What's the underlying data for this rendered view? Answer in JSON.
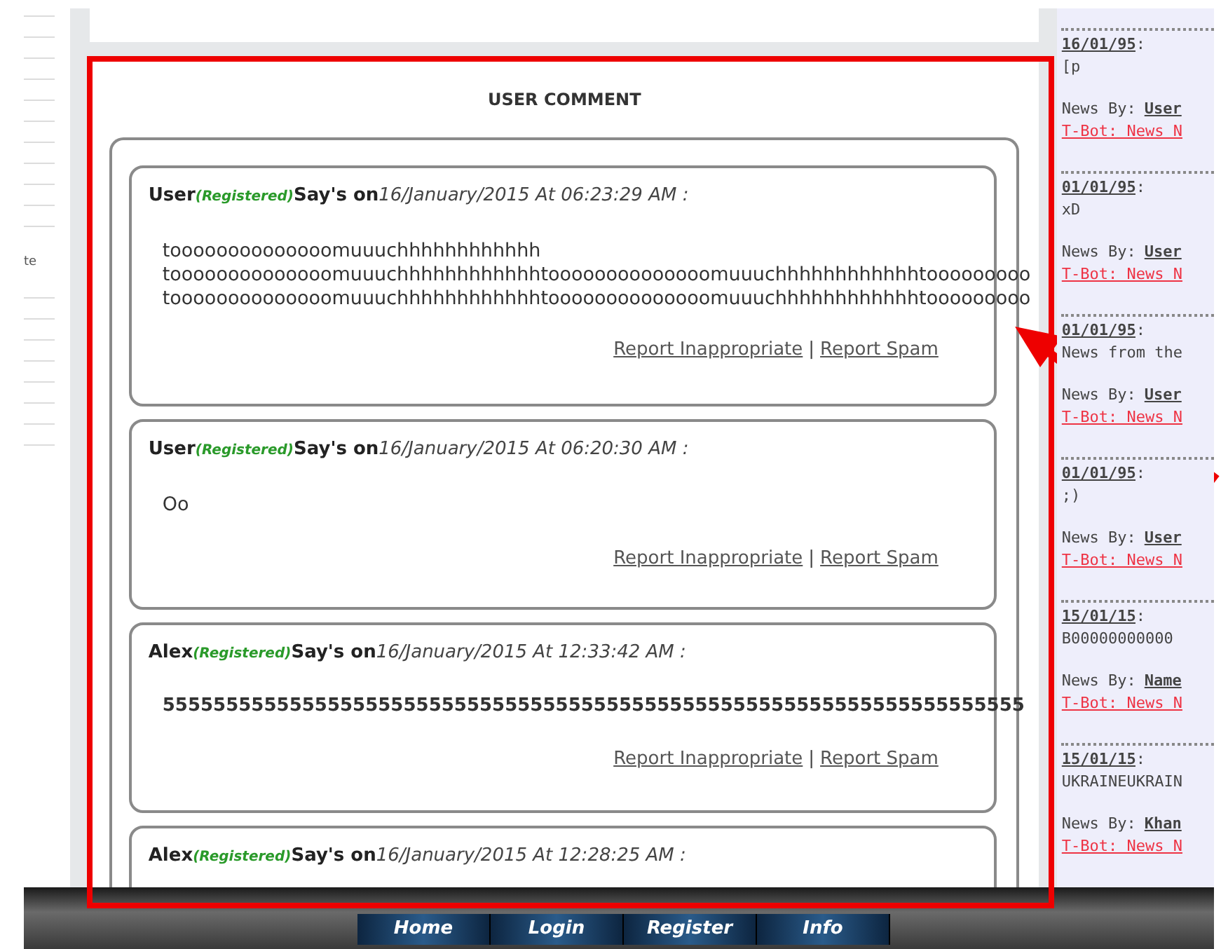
{
  "left_strip": {
    "text": "te"
  },
  "title": "USER COMMENT",
  "comments": [
    {
      "author": "User",
      "status": "(Registered)",
      "says": "Say's on",
      "date": "16/January/2015 At 06:23:29 AM :",
      "bold_body": false,
      "body": [
        "toooooooooooooomuuuchhhhhhhhhhhh",
        "toooooooooooooomuuuchhhhhhhhhhhhtoooooooooooooomuuuchhhhhhhhhhhhtooooooooo",
        "toooooooooooooomuuuchhhhhhhhhhhhtoooooooooooooomuuuchhhhhhhhhhhhtooooooooo"
      ],
      "links": [
        "Report Inappropriate",
        "Report Spam"
      ],
      "separator": "|"
    },
    {
      "author": "User",
      "status": "(Registered)",
      "says": "Say's on",
      "date": "16/January/2015 At 06:20:30 AM :",
      "bold_body": false,
      "body": [
        "Oo"
      ],
      "links": [
        "Report Inappropriate",
        "Report Spam"
      ],
      "separator": "|"
    },
    {
      "author": "Alex",
      "status": "(Registered)",
      "says": "Say's on",
      "date": "16/January/2015 At 12:33:42 AM :",
      "body": [
        "55555555555555555555555555555555555555555555555555555555555555555555"
      ],
      "bold_body": true,
      "links": [
        "Report Inappropriate",
        "Report Spam"
      ],
      "separator": "|"
    },
    {
      "author": "Alex",
      "status": "(Registered)",
      "says": "Say's on",
      "date": "16/January/2015 At 12:28:25 AM :"
    }
  ],
  "news": [
    {
      "date": "16/01/95",
      "colon": ":",
      "text": "[p",
      "by_label": "News By:",
      "author": "User",
      "tag": "T-Bot: News N"
    },
    {
      "date": "01/01/95",
      "colon": ":",
      "text": "xD",
      "by_label": "News By:",
      "author": "User",
      "tag": "T-Bot: News N"
    },
    {
      "date": "01/01/95",
      "colon": ":",
      "text": "News from the",
      "by_label": "News By:",
      "author": "User",
      "tag": "T-Bot: News N"
    },
    {
      "date": "01/01/95",
      "colon": ":",
      "text": ";)",
      "by_label": "News By:",
      "author": "User",
      "tag": "T-Bot: News N"
    },
    {
      "date": "15/01/15",
      "colon": ":",
      "text": "B00000000000",
      "by_label": "News By:",
      "author": "Name",
      "tag": "T-Bot: News N"
    },
    {
      "date": "15/01/15",
      "colon": ":",
      "text": "UKRAINEUKRAIN",
      "by_label": "News By:",
      "author": "Khan",
      "tag": "T-Bot: News N"
    }
  ],
  "nav": [
    {
      "label": "Home"
    },
    {
      "label": "Login"
    },
    {
      "label": "Register"
    },
    {
      "label": "Info"
    }
  ]
}
